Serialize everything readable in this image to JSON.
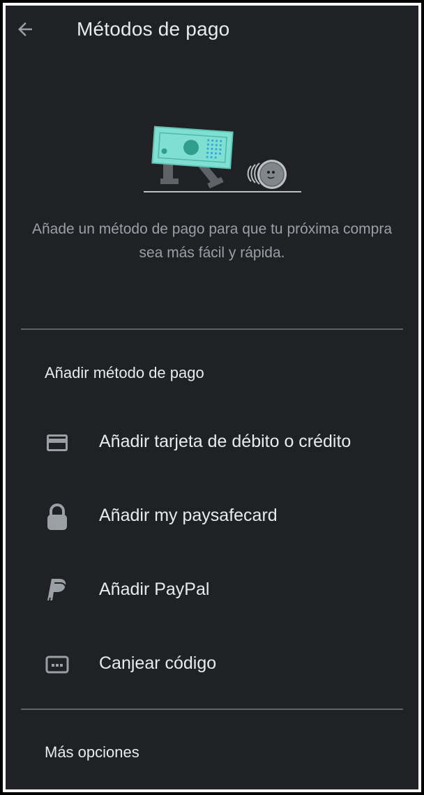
{
  "header": {
    "title": "Métodos de pago",
    "back_icon": "arrow-back-icon"
  },
  "empty_state": {
    "illustration": "running-money-illustration",
    "description": "Añade un método de pago para que tu próxima compra sea más fácil y rápida."
  },
  "add_section": {
    "title": "Añadir método de pago",
    "options": [
      {
        "icon": "credit-card-icon",
        "label": "Añadir tarjeta de débito o crédito"
      },
      {
        "icon": "lock-icon",
        "label": "Añadir my paysafecard"
      },
      {
        "icon": "paypal-icon",
        "label": "Añadir PayPal"
      },
      {
        "icon": "redeem-code-icon",
        "label": "Canjear código"
      }
    ]
  },
  "more_options": "Más opciones",
  "colors": {
    "background": "#202124",
    "text_primary": "#e8eaed",
    "text_secondary": "#9aa0a6",
    "divider": "#5f6368",
    "icon": "#9aa0a6",
    "illustration_accent": "#7fe0d2"
  }
}
